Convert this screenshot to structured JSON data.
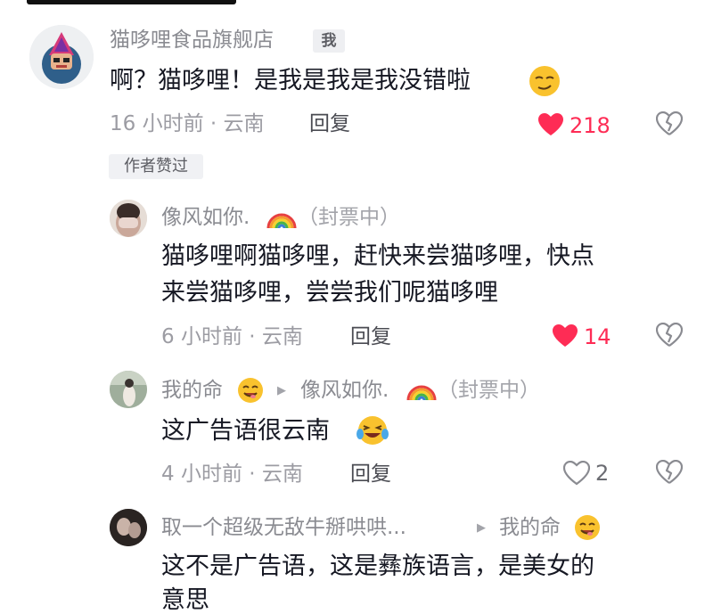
{
  "top_comment": {
    "author": "猫哆哩食品旗舰店",
    "badge": "我",
    "text": "啊？猫哆哩！是我是我是我没错啦",
    "time": "16 小时前 · 云南",
    "reply_label": "回复",
    "like_count": "218",
    "liked_by_author_tag": "作者赞过"
  },
  "replies": [
    {
      "author": "像风如你.",
      "author_suffix": "（封票中）",
      "text_lines": [
        "猫哆哩啊猫哆哩，赶快来尝猫哆哩，快点",
        "来尝猫哆哩，尝尝我们呢猫哆哩"
      ],
      "time": "6 小时前 · 云南",
      "reply_label": "回复",
      "like_count": "14"
    },
    {
      "author": "我的命",
      "reply_to": "像风如你.",
      "reply_to_suffix": "（封票中）",
      "text": "这广告语很云南",
      "time": "4 小时前 · 云南",
      "reply_label": "回复",
      "like_count": "2"
    },
    {
      "author": "取一个超级无敌牛掰哄哄...",
      "reply_to": "我的命",
      "text_lines": [
        "这不是广告语，这是彝族语言，是美女的",
        "意思"
      ]
    }
  ],
  "colors": {
    "like_red": "#fe2c55",
    "meta_gray": "#9c9ca3"
  }
}
